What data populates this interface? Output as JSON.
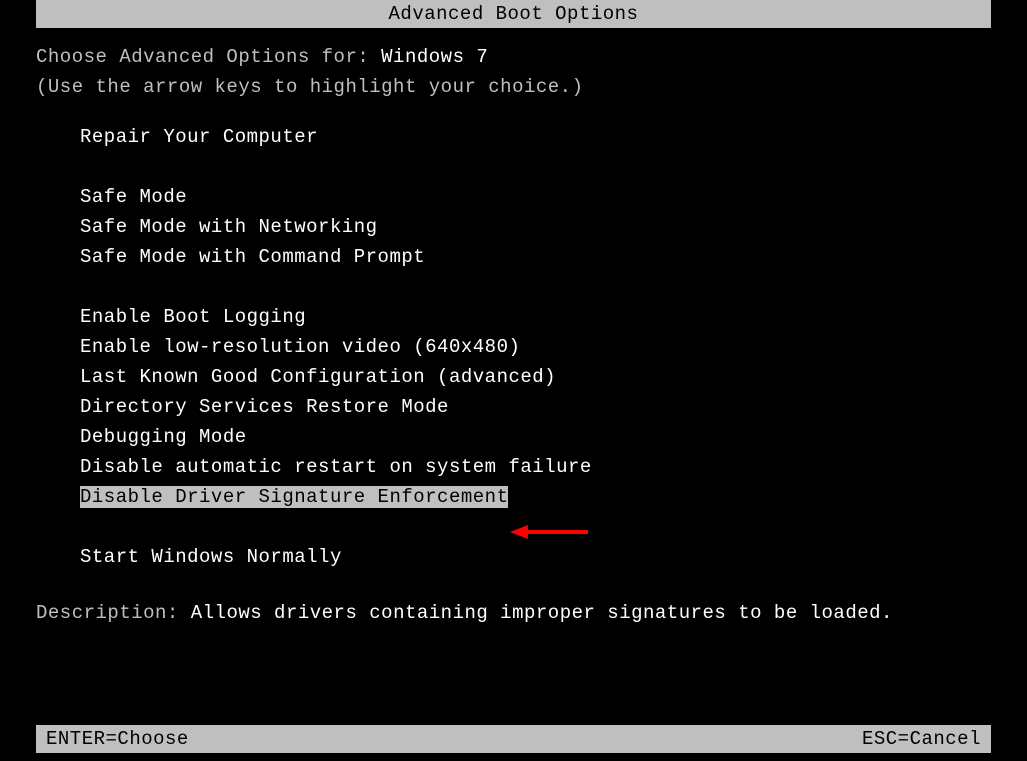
{
  "title": "Advanced Boot Options",
  "prompt_prefix": "Choose Advanced Options for: ",
  "os_name": "Windows 7",
  "hint": "(Use the arrow keys to highlight your choice.)",
  "groups": {
    "g0": [
      "Repair Your Computer"
    ],
    "g1": [
      "Safe Mode",
      "Safe Mode with Networking",
      "Safe Mode with Command Prompt"
    ],
    "g2": [
      "Enable Boot Logging",
      "Enable low-resolution video (640x480)",
      "Last Known Good Configuration (advanced)",
      "Directory Services Restore Mode",
      "Debugging Mode",
      "Disable automatic restart on system failure",
      "Disable Driver Signature Enforcement"
    ],
    "g3": [
      "Start Windows Normally"
    ]
  },
  "description_label": "Description: ",
  "description_text": "Allows drivers containing improper signatures to be loaded.",
  "footer": {
    "enter": "ENTER=Choose",
    "esc": "ESC=Cancel"
  },
  "selected_option": "Disable Driver Signature Enforcement"
}
